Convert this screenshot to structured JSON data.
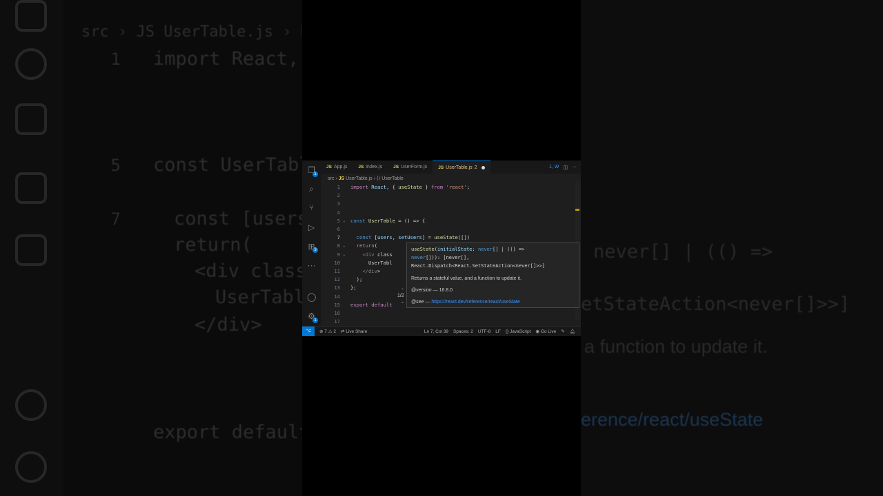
{
  "tabs": [
    {
      "icon": "JS",
      "label": "App.js"
    },
    {
      "icon": "JS",
      "label": "index.js"
    },
    {
      "icon": "JS",
      "label": "UserForm.js"
    },
    {
      "icon": "JS",
      "label": "UserTable.js",
      "problems": "2"
    }
  ],
  "tab_actions": {
    "timeline": "1, W",
    "more": "···"
  },
  "breadcrumb": {
    "folder": "src",
    "file_icon": "JS",
    "file": "UserTable.js",
    "symbol": "UserTable"
  },
  "activity_badges": {
    "explorer": "1",
    "extensions": "3",
    "settings": "1"
  },
  "code_lines": [
    {
      "n": "1",
      "text": "import React, { useState } from 'react';"
    },
    {
      "n": "2",
      "text": ""
    },
    {
      "n": "3",
      "text": ""
    },
    {
      "n": "4",
      "text": ""
    },
    {
      "n": "5",
      "text": "const UserTable = () => {"
    },
    {
      "n": "6",
      "text": ""
    },
    {
      "n": "7",
      "text": "  const [users, setUsers] = useState([])"
    },
    {
      "n": "8",
      "text": "  return("
    },
    {
      "n": "9",
      "text": "    <div class"
    },
    {
      "n": "10",
      "text": "      UserTabl"
    },
    {
      "n": "11",
      "text": "    </div>"
    },
    {
      "n": "12",
      "text": "  );"
    },
    {
      "n": "13",
      "text": "};"
    },
    {
      "n": "14",
      "text": ""
    },
    {
      "n": "15",
      "text": "export default"
    },
    {
      "n": "16",
      "text": ""
    },
    {
      "n": "17",
      "text": ""
    }
  ],
  "hover": {
    "sig1": "useState(initialState: never[] | (() =>",
    "sig2": "never[])): [never[],",
    "sig3": "React.Dispatch<React.SetStateAction<never[]>>]",
    "description": "Returns a stateful value, and a function to update it.",
    "version_tag": "@version",
    "version": "— 16.8.0",
    "see_tag": "@see",
    "see_dash": "—",
    "see_link": "https://react.dev/reference/react/useState",
    "pager": "1/2"
  },
  "status": {
    "errors": "7",
    "warnings": "2",
    "live_share": "Live Share",
    "position": "Ln 7, Col 39",
    "spaces": "Spaces: 2",
    "encoding": "UTF-8",
    "eol": "LF",
    "braces": "{}",
    "language": "JavaScript",
    "go_live": "Go Live"
  },
  "colors": {
    "accent": "#0078d4",
    "background": "#1e1e1e",
    "modified_tab": "#e2c08d",
    "js_icon": "#e6cd45"
  }
}
